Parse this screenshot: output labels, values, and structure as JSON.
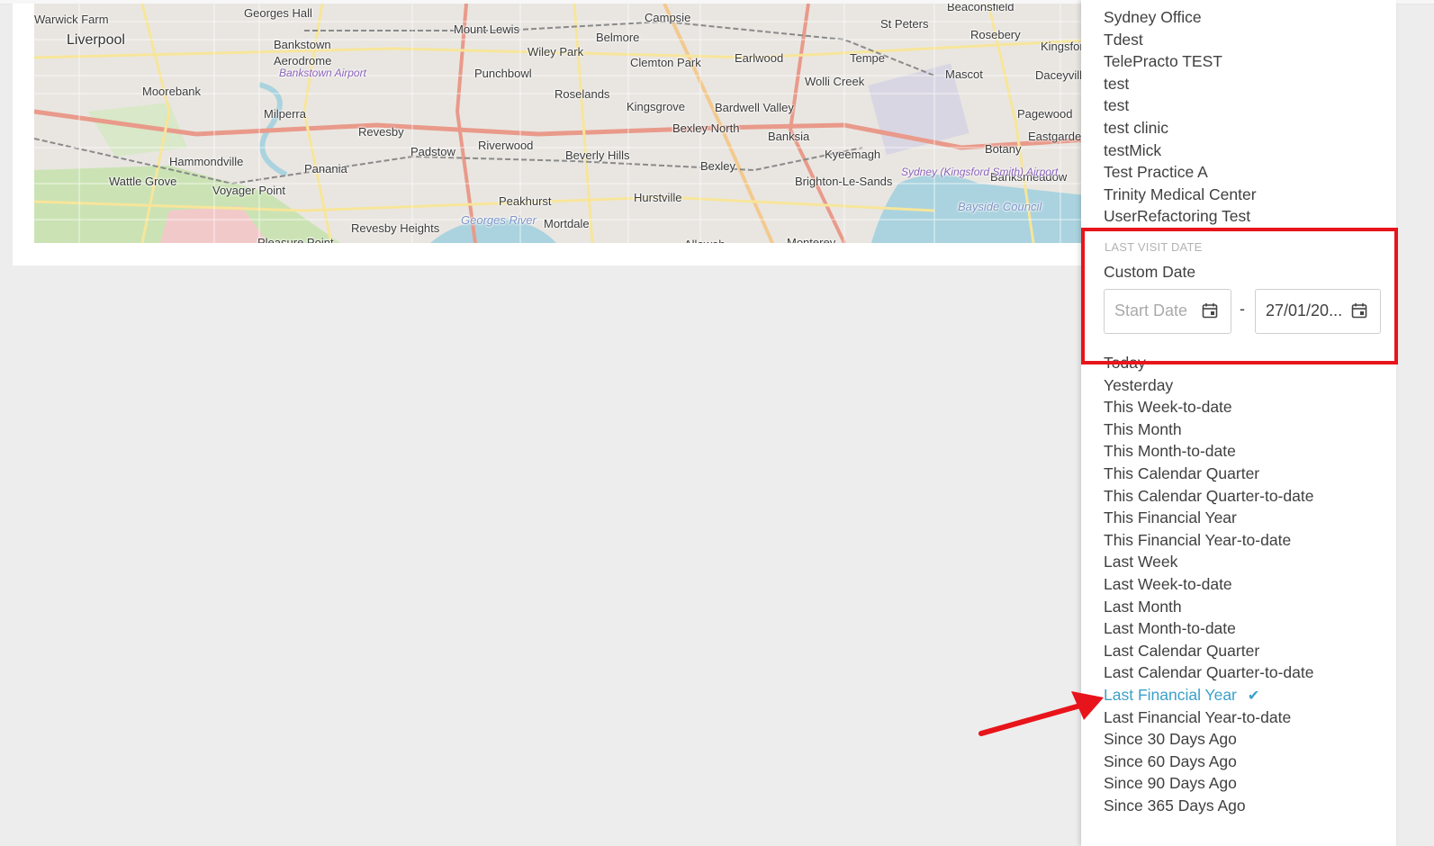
{
  "map": {
    "labels": [
      {
        "text": "Warwick Farm",
        "cls": ""
      },
      {
        "text": "Liverpool",
        "cls": "big"
      },
      {
        "text": "Georges Hall",
        "cls": ""
      },
      {
        "text": "Bankstown",
        "cls": ""
      },
      {
        "text": "Aerodrome",
        "cls": ""
      },
      {
        "text": "Bankstown Airport",
        "cls": "airport"
      },
      {
        "text": "Moorebank",
        "cls": ""
      },
      {
        "text": "Milperra",
        "cls": ""
      },
      {
        "text": "Revesby",
        "cls": ""
      },
      {
        "text": "Hammondville",
        "cls": ""
      },
      {
        "text": "Panania",
        "cls": ""
      },
      {
        "text": "Wattle Grove",
        "cls": ""
      },
      {
        "text": "Voyager Point",
        "cls": ""
      },
      {
        "text": "Revesby Heights",
        "cls": ""
      },
      {
        "text": "Georges River",
        "cls": "water"
      },
      {
        "text": "Padstow",
        "cls": ""
      },
      {
        "text": "Riverwood",
        "cls": ""
      },
      {
        "text": "Peakhurst",
        "cls": ""
      },
      {
        "text": "Mortdale",
        "cls": ""
      },
      {
        "text": "Mount Lewis",
        "cls": ""
      },
      {
        "text": "Campsie",
        "cls": ""
      },
      {
        "text": "Belmore",
        "cls": ""
      },
      {
        "text": "Wiley Park",
        "cls": ""
      },
      {
        "text": "Punchbowl",
        "cls": ""
      },
      {
        "text": "Roselands",
        "cls": ""
      },
      {
        "text": "Clemton Park",
        "cls": ""
      },
      {
        "text": "Earlwood",
        "cls": ""
      },
      {
        "text": "Kingsgrove",
        "cls": ""
      },
      {
        "text": "Bardwell Valley",
        "cls": ""
      },
      {
        "text": "Bexley North",
        "cls": ""
      },
      {
        "text": "Beverly Hills",
        "cls": ""
      },
      {
        "text": "Bexley",
        "cls": ""
      },
      {
        "text": "Hurstville",
        "cls": ""
      },
      {
        "text": "Banksia",
        "cls": ""
      },
      {
        "text": "Kyeemagh",
        "cls": ""
      },
      {
        "text": "Brighton-Le-Sands",
        "cls": ""
      },
      {
        "text": "Tempe",
        "cls": ""
      },
      {
        "text": "Wolli Creek",
        "cls": ""
      },
      {
        "text": "St Peters",
        "cls": ""
      },
      {
        "text": "Beaconsfield",
        "cls": ""
      },
      {
        "text": "Rosebery",
        "cls": ""
      },
      {
        "text": "Mascot",
        "cls": ""
      },
      {
        "text": "Kingsford",
        "cls": ""
      },
      {
        "text": "Daceyville",
        "cls": ""
      },
      {
        "text": "Pagewood",
        "cls": ""
      },
      {
        "text": "Eastgardens",
        "cls": ""
      },
      {
        "text": "Botany",
        "cls": ""
      },
      {
        "text": "Banksmeadow",
        "cls": ""
      },
      {
        "text": "Sydney (Kingsford Smith) Airport",
        "cls": "airport"
      },
      {
        "text": "Bayside Council",
        "cls": "water"
      },
      {
        "text": "Pleasure Point",
        "cls": ""
      },
      {
        "text": "Allawah",
        "cls": ""
      },
      {
        "text": "Monterey",
        "cls": ""
      }
    ]
  },
  "practices": [
    "Sydney Office",
    "Tdest",
    "TelePracto TEST",
    "test",
    "test",
    "test clinic",
    "testMick",
    "Test Practice A",
    "Trinity Medical Center",
    "UserRefactoring Test"
  ],
  "last_visit": {
    "section_label": "LAST VISIT DATE",
    "custom_date_label": "Custom Date",
    "start_placeholder": "Start Date",
    "end_value": "27/01/20...",
    "separator": "-"
  },
  "date_options": [
    {
      "label": "Today",
      "selected": false
    },
    {
      "label": "Yesterday",
      "selected": false
    },
    {
      "label": "This Week-to-date",
      "selected": false
    },
    {
      "label": "This Month",
      "selected": false
    },
    {
      "label": "This Month-to-date",
      "selected": false
    },
    {
      "label": "This Calendar Quarter",
      "selected": false
    },
    {
      "label": "This Calendar Quarter-to-date",
      "selected": false
    },
    {
      "label": "This Financial Year",
      "selected": false
    },
    {
      "label": "This Financial Year-to-date",
      "selected": false
    },
    {
      "label": "Last Week",
      "selected": false
    },
    {
      "label": "Last Week-to-date",
      "selected": false
    },
    {
      "label": "Last Month",
      "selected": false
    },
    {
      "label": "Last Month-to-date",
      "selected": false
    },
    {
      "label": "Last Calendar Quarter",
      "selected": false
    },
    {
      "label": "Last Calendar Quarter-to-date",
      "selected": false
    },
    {
      "label": "Last Financial Year",
      "selected": true
    },
    {
      "label": "Last Financial Year-to-date",
      "selected": false
    },
    {
      "label": "Since 30 Days Ago",
      "selected": false
    },
    {
      "label": "Since 60 Days Ago",
      "selected": false
    },
    {
      "label": "Since 90 Days Ago",
      "selected": false
    },
    {
      "label": "Since 365 Days Ago",
      "selected": false
    }
  ],
  "colors": {
    "selected": "#3ca0c8",
    "annotation": "#e8141b",
    "text": "#404040",
    "section_label": "#b3b3b3"
  },
  "icons": {
    "calendar": "calendar-icon",
    "check": "check-icon",
    "arrow": "red-arrow-annotation"
  }
}
